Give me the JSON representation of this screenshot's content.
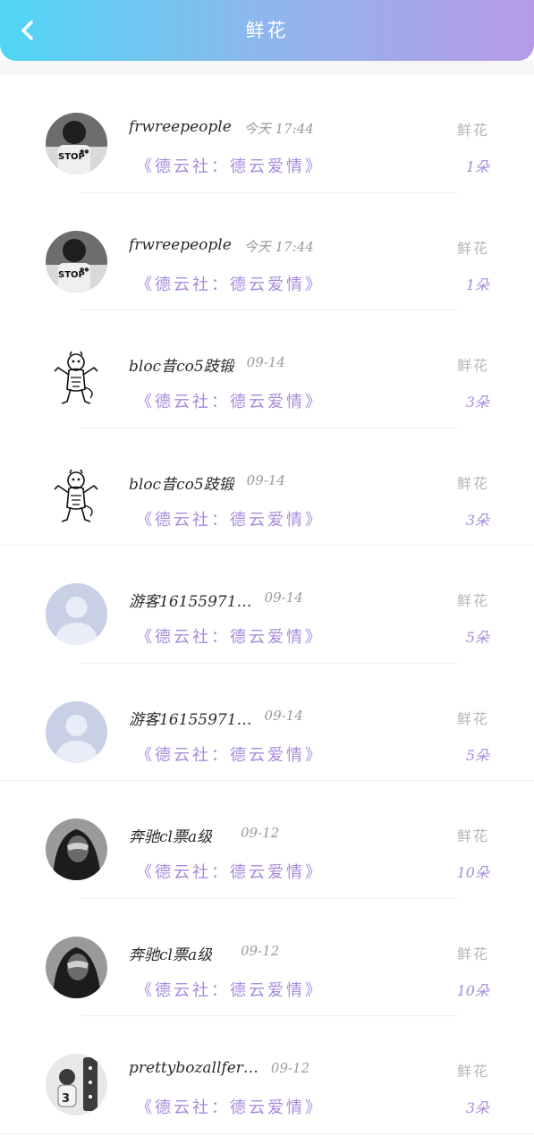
{
  "header": {
    "title": "鲜花",
    "back_icon": "chevron-left-icon",
    "gradient_colors": [
      "#4fd6f5",
      "#b79ae9"
    ]
  },
  "accent_color": "#a78bdc",
  "records": [
    {
      "name": "frwreepeople",
      "time": "今天 17:44",
      "type": "鲜花",
      "room": "《德云社：德云爱情》",
      "count": "1朵",
      "avatar": "stop-photo"
    },
    {
      "name": "frwreepeople",
      "time": "今天 17:44",
      "type": "鲜花",
      "room": "《德云社：德云爱情》",
      "count": "1朵",
      "avatar": "stop-photo"
    },
    {
      "name": "bloc昔co5跂锻",
      "time": "09-14",
      "type": "鲜花",
      "room": "《德云社：德云爱情》",
      "count": "3朵",
      "avatar": "tiger-sketch"
    },
    {
      "name": "bloc昔co5跂锻",
      "time": "09-14",
      "type": "鲜花",
      "room": "《德云社：德云爱情》",
      "count": "3朵",
      "avatar": "tiger-sketch"
    },
    {
      "name": "游客16155971…",
      "time": "09-14",
      "type": "鲜花",
      "room": "《德云社：德云爱情》",
      "count": "5朵",
      "avatar": "default-user"
    },
    {
      "name": "游客16155971…",
      "time": "09-14",
      "type": "鲜花",
      "room": "《德云社：德云爱情》",
      "count": "5朵",
      "avatar": "default-user"
    },
    {
      "name": "奔驰cl票a级",
      "time": "09-12",
      "type": "鲜花",
      "room": "《德云社：德云爱情》",
      "count": "10朵",
      "avatar": "masked-photo"
    },
    {
      "name": "奔驰cl票a级",
      "time": "09-12",
      "type": "鲜花",
      "room": "《德云社：德云爱情》",
      "count": "10朵",
      "avatar": "masked-photo"
    },
    {
      "name": "prettybozallfer…",
      "time": "09-12",
      "type": "鲜花",
      "room": "《德云社：德云爱情》",
      "count": "3朵",
      "avatar": "child-photo"
    }
  ]
}
